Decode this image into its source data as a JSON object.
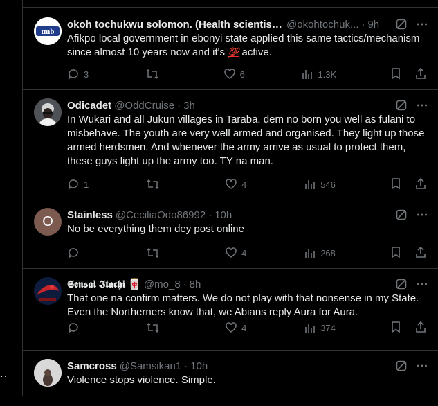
{
  "left": {
    "more_dots": "··"
  },
  "tweets": [
    {
      "name": "okoh tochukwu solomon. (Health scientist...",
      "handle": "@okohtochuk...",
      "time": "9h",
      "avatar_text": "tmb",
      "text": "Afikpo local government in ebonyi state applied this same tactics/mechanism since almost 10 years now and it's ",
      "emoji": "💯",
      "text_after": " active.",
      "replies": "3",
      "retweets": "",
      "likes": "6",
      "views": "1.3K"
    },
    {
      "name": "Odicadet",
      "handle": "@OddCruise",
      "time": "3h",
      "text": "In Wukari and all Jukun villages in Taraba, dem no born you well as fulani to misbehave. The youth are very well armed and organised. They light up those armed herdsmen. And whenever the army arrive as usual to protect them, these guys light up the army too. TY na man.",
      "replies": "1",
      "retweets": "",
      "likes": "4",
      "views": "546"
    },
    {
      "name": "Stainless",
      "handle": "@CeciliaOdo86992",
      "time": "10h",
      "avatar_text": "O",
      "text": "No be everything them dey post online",
      "replies": "",
      "retweets": "",
      "likes": "4",
      "views": "268"
    },
    {
      "name": "𝕾𝖊𝖓𝖘𝖆𝖎 𝕴𝖙𝖆𝖈𝖍𝖎 🀄",
      "handle": "@mo_8",
      "time": "8h",
      "text": "That one na confirm matters. We do not play with that nonsense in my State. Even the Northerners know that, we Abians reply Aura for Aura.",
      "replies": "",
      "retweets": "",
      "likes": "4",
      "views": "374"
    },
    {
      "name": "Samcross",
      "handle": "@Samsikan1",
      "time": "10h",
      "text": "Violence stops violence. Simple."
    }
  ],
  "colors": {
    "muted": "#71767b",
    "divider": "#2f3336",
    "text": "#e7e9ea",
    "bg": "#000000"
  },
  "icons": [
    "grok-icon",
    "more-icon",
    "reply-icon",
    "retweet-icon",
    "like-icon",
    "views-icon",
    "bookmark-icon",
    "share-icon"
  ]
}
